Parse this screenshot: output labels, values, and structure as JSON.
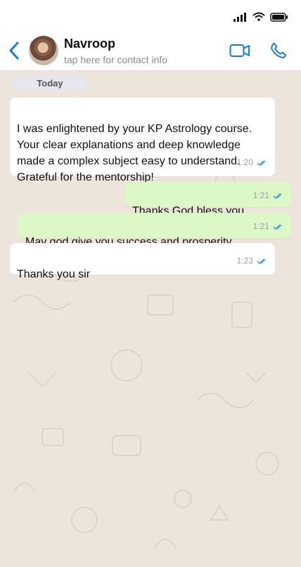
{
  "header": {
    "name": "Navroop",
    "subtitle": "tap here for contact info"
  },
  "chat": {
    "date_label": "Today",
    "messages": [
      {
        "text": "I was enlightened by your KP Astrology course.\nYour clear explanations and deep knowledge\nmade a complex subject easy to understand.\nGrateful for the mentorship!",
        "time": "1:20"
      },
      {
        "text": "Thanks God bless you",
        "time": "1:21"
      },
      {
        "text": "May god give you success and prosperity",
        "time": "1:21"
      },
      {
        "text": "Thanks you sir",
        "time": "1:23"
      }
    ]
  },
  "icons": {
    "back": "chevron-left-icon",
    "video": "video-camera-icon",
    "call": "phone-icon"
  },
  "colors": {
    "accent": "#1a7bd8",
    "incoming": "#ffffff",
    "outgoing": "#dcf8c6",
    "background": "#ede5dc",
    "read_ticks": "#4aa3df"
  }
}
